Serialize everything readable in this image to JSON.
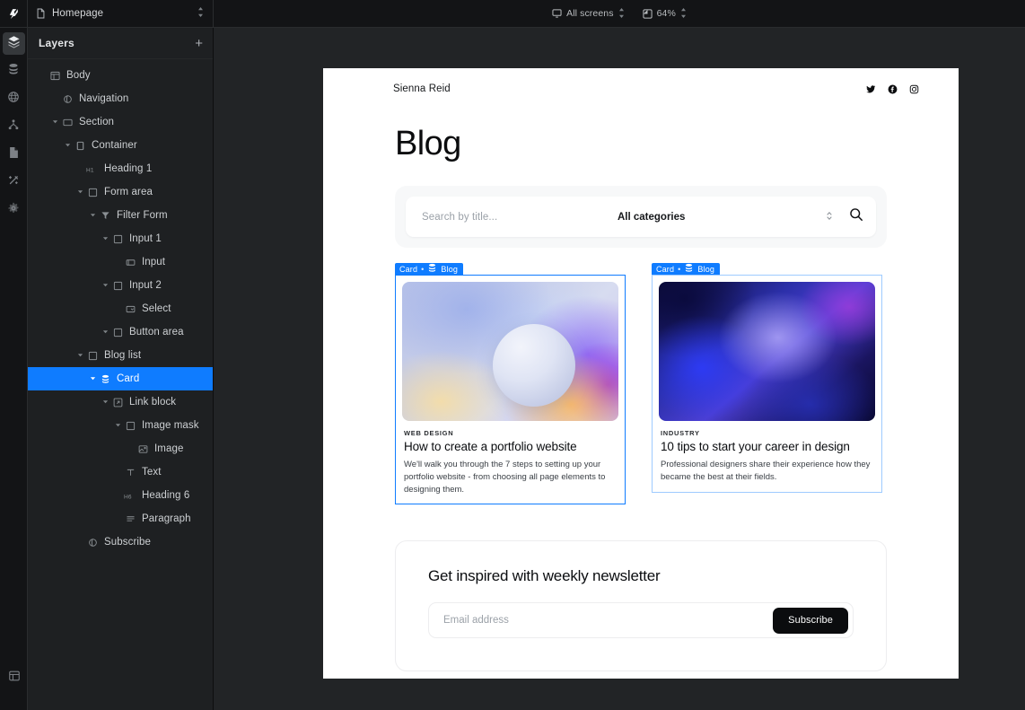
{
  "topbar": {
    "logo_icon": "webflow-logo-icon",
    "page_icon": "page-file-icon",
    "page_name": "Homepage",
    "page_stepper_icon": "stepper-updown-icon",
    "screen_icon": "monitor-icon",
    "screen_label": "All screens",
    "screen_stepper_icon": "stepper-updown-icon",
    "zoom_icon": "zoom-box-icon",
    "zoom_label": "64%",
    "zoom_stepper_icon": "stepper-updown-icon"
  },
  "rail": {
    "items": [
      {
        "icon": "layers-icon",
        "name": "rail-layers",
        "active": true
      },
      {
        "icon": "database-icon",
        "name": "rail-cms",
        "active": false
      },
      {
        "icon": "globe-icon",
        "name": "rail-localization",
        "active": false
      },
      {
        "icon": "sitemap-icon",
        "name": "rail-components",
        "active": false
      },
      {
        "icon": "page-icon",
        "name": "rail-pages",
        "active": false
      },
      {
        "icon": "wand-icon",
        "name": "rail-style",
        "active": false
      },
      {
        "icon": "gear-icon",
        "name": "rail-settings",
        "active": false
      }
    ],
    "bottom_icon": "panel-toggle-icon"
  },
  "layers": {
    "title": "Layers",
    "add_label": "+",
    "nodes": [
      {
        "label": "Body",
        "indent": 0,
        "caret": false,
        "icon": "body-frame-icon",
        "selected": false
      },
      {
        "label": "Navigation",
        "indent": 1,
        "caret": false,
        "icon": "component-icon",
        "selected": false
      },
      {
        "label": "Section",
        "indent": 1,
        "caret": true,
        "icon": "section-icon",
        "selected": false
      },
      {
        "label": "Container",
        "indent": 2,
        "caret": true,
        "icon": "container-icon",
        "selected": false
      },
      {
        "label": "Heading 1",
        "indent": 3,
        "caret": false,
        "icon": "h1-icon",
        "selected": false
      },
      {
        "label": "Form area",
        "indent": 3,
        "caret": true,
        "icon": "block-icon",
        "selected": false
      },
      {
        "label": "Filter Form",
        "indent": 4,
        "caret": true,
        "icon": "form-icon",
        "selected": false
      },
      {
        "label": "Input 1",
        "indent": 5,
        "caret": true,
        "icon": "block-icon",
        "selected": false
      },
      {
        "label": "Input",
        "indent": 6,
        "caret": false,
        "icon": "input-icon",
        "selected": false
      },
      {
        "label": "Input 2",
        "indent": 5,
        "caret": true,
        "icon": "block-icon",
        "selected": false
      },
      {
        "label": "Select",
        "indent": 6,
        "caret": false,
        "icon": "select-icon",
        "selected": false
      },
      {
        "label": "Button area",
        "indent": 5,
        "caret": true,
        "icon": "block-icon",
        "selected": false
      },
      {
        "label": "Blog list",
        "indent": 3,
        "caret": true,
        "icon": "block-icon",
        "selected": false
      },
      {
        "label": "Card",
        "indent": 4,
        "caret": true,
        "icon": "collection-icon",
        "selected": true
      },
      {
        "label": "Link block",
        "indent": 5,
        "caret": true,
        "icon": "link-block-icon",
        "selected": false
      },
      {
        "label": "Image mask",
        "indent": 6,
        "caret": true,
        "icon": "block-icon",
        "selected": false
      },
      {
        "label": "Image",
        "indent": 7,
        "caret": false,
        "icon": "image-icon",
        "selected": false
      },
      {
        "label": "Text",
        "indent": 6,
        "caret": false,
        "icon": "text-icon",
        "selected": false
      },
      {
        "label": "Heading 6",
        "indent": 6,
        "caret": false,
        "icon": "h6-icon",
        "selected": false
      },
      {
        "label": "Paragraph",
        "indent": 6,
        "caret": false,
        "icon": "paragraph-icon",
        "selected": false
      },
      {
        "label": "Subscribe",
        "indent": 3,
        "caret": false,
        "icon": "component-icon",
        "selected": false
      }
    ]
  },
  "canvas": {
    "site": {
      "brand": "Sienna Reid",
      "socials": [
        {
          "name": "twitter-icon",
          "label": "Twitter"
        },
        {
          "name": "facebook-icon",
          "label": "Facebook"
        },
        {
          "name": "instagram-icon",
          "label": "Instagram"
        }
      ],
      "heading": "Blog",
      "filter": {
        "search_placeholder": "Search by title...",
        "search_value": "",
        "category_selected": "All categories",
        "select_chevron_icon": "chevron-updown-icon",
        "search_button_icon": "search-icon"
      },
      "cards": [
        {
          "badge_element": "Card",
          "badge_sep": "•",
          "badge_collection_icon": "collection-icon",
          "badge_collection": "Blog",
          "category": "WEB DESIGN",
          "title": "How to create a portfolio website",
          "paragraph": "We'll walk you through the 7 steps to setting up your portfolio website - from choosing all page elements to designing them.",
          "thumb": "g1"
        },
        {
          "badge_element": "Card",
          "badge_sep": "•",
          "badge_collection_icon": "collection-icon",
          "badge_collection": "Blog",
          "category": "INDUSTRY",
          "title": "10 tips to start your career in design",
          "paragraph": "Professional designers share their experience how they became the best at their fields.",
          "thumb": "g2"
        }
      ],
      "subscribe": {
        "heading": "Get inspired with weekly newsletter",
        "email_placeholder": "Email address",
        "email_value": "",
        "button_label": "Subscribe"
      }
    }
  },
  "colors": {
    "accent": "#0f7cff",
    "accent_soft": "#9ecbff",
    "canvas_bg": "#222426",
    "panel_bg": "#1e2022",
    "topbar_bg": "#131416",
    "page_bg": "#ffffff",
    "dark_button": "#0b0c0e"
  }
}
